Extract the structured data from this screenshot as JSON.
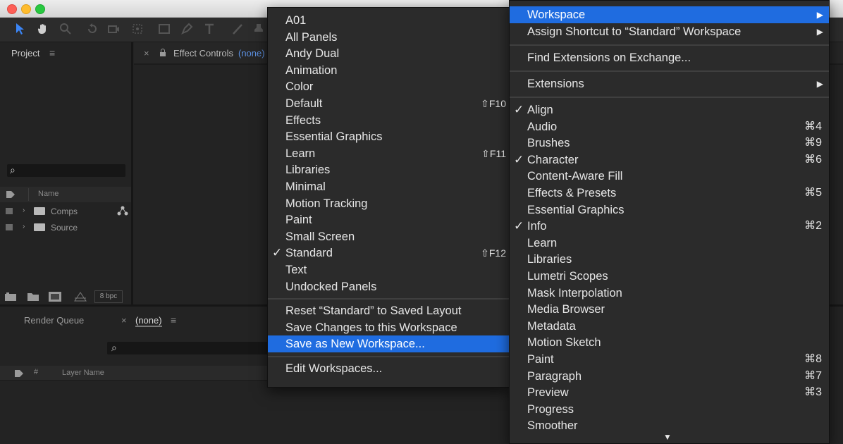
{
  "toolbar_icons": [
    "selection-tool-icon",
    "hand-tool-icon",
    "zoom-tool-icon",
    "rotate-tool-icon",
    "camera-tool-icon",
    "pan-behind-icon",
    "rectangle-tool-icon",
    "pen-tool-icon",
    "type-tool-icon",
    "brush-tool-icon",
    "clone-stamp-icon"
  ],
  "project": {
    "title": "Project",
    "menu_icon": "≡",
    "search_icon": "⌕",
    "column_name": "Name",
    "rows": [
      {
        "label": "Comps"
      },
      {
        "label": "Source"
      }
    ],
    "bpc": "8 bpc"
  },
  "effect_controls": {
    "title": "Effect Controls",
    "value": "(none)"
  },
  "timeline": {
    "render_queue": "Render Queue",
    "tab": "(none)",
    "col_hash": "#",
    "col_layer": "Layer Name"
  },
  "workspace_menu": {
    "items": [
      {
        "label": "A01"
      },
      {
        "label": "All Panels"
      },
      {
        "label": "Andy Dual"
      },
      {
        "label": "Animation"
      },
      {
        "label": "Color"
      },
      {
        "label": "Default",
        "shortcut": "⇧F10"
      },
      {
        "label": "Effects"
      },
      {
        "label": "Essential Graphics"
      },
      {
        "label": "Learn",
        "shortcut": "⇧F11"
      },
      {
        "label": "Libraries"
      },
      {
        "label": "Minimal"
      },
      {
        "label": "Motion Tracking"
      },
      {
        "label": "Paint"
      },
      {
        "label": "Small Screen"
      },
      {
        "label": "Standard",
        "shortcut": "⇧F12",
        "checked": true
      },
      {
        "label": "Text"
      },
      {
        "label": "Undocked Panels"
      }
    ],
    "actions": [
      {
        "label": "Reset “Standard” to Saved Layout"
      },
      {
        "label": "Save Changes to this Workspace"
      },
      {
        "label": "Save as New Workspace...",
        "highlighted": true
      }
    ],
    "edit": "Edit Workspaces..."
  },
  "window_menu": {
    "top": [
      {
        "label": "Workspace",
        "submenu": true,
        "highlighted": true
      },
      {
        "label": "Assign Shortcut to “Standard” Workspace",
        "submenu": true
      }
    ],
    "find": "Find Extensions on Exchange...",
    "extensions": "Extensions",
    "panels": [
      {
        "label": "Align",
        "checked": true
      },
      {
        "label": "Audio",
        "shortcut": "⌘4"
      },
      {
        "label": "Brushes",
        "shortcut": "⌘9"
      },
      {
        "label": "Character",
        "checked": true,
        "shortcut": "⌘6"
      },
      {
        "label": "Content-Aware Fill"
      },
      {
        "label": "Effects & Presets",
        "shortcut": "⌘5"
      },
      {
        "label": "Essential Graphics"
      },
      {
        "label": "Info",
        "checked": true,
        "shortcut": "⌘2"
      },
      {
        "label": "Learn"
      },
      {
        "label": "Libraries"
      },
      {
        "label": "Lumetri Scopes"
      },
      {
        "label": "Mask Interpolation"
      },
      {
        "label": "Media Browser"
      },
      {
        "label": "Metadata"
      },
      {
        "label": "Motion Sketch"
      },
      {
        "label": "Paint",
        "shortcut": "⌘8"
      },
      {
        "label": "Paragraph",
        "shortcut": "⌘7"
      },
      {
        "label": "Preview",
        "shortcut": "⌘3"
      },
      {
        "label": "Progress"
      },
      {
        "label": "Smoother"
      }
    ],
    "scroll_arrow": "▼",
    "check": "✓",
    "arrow": "▶"
  }
}
